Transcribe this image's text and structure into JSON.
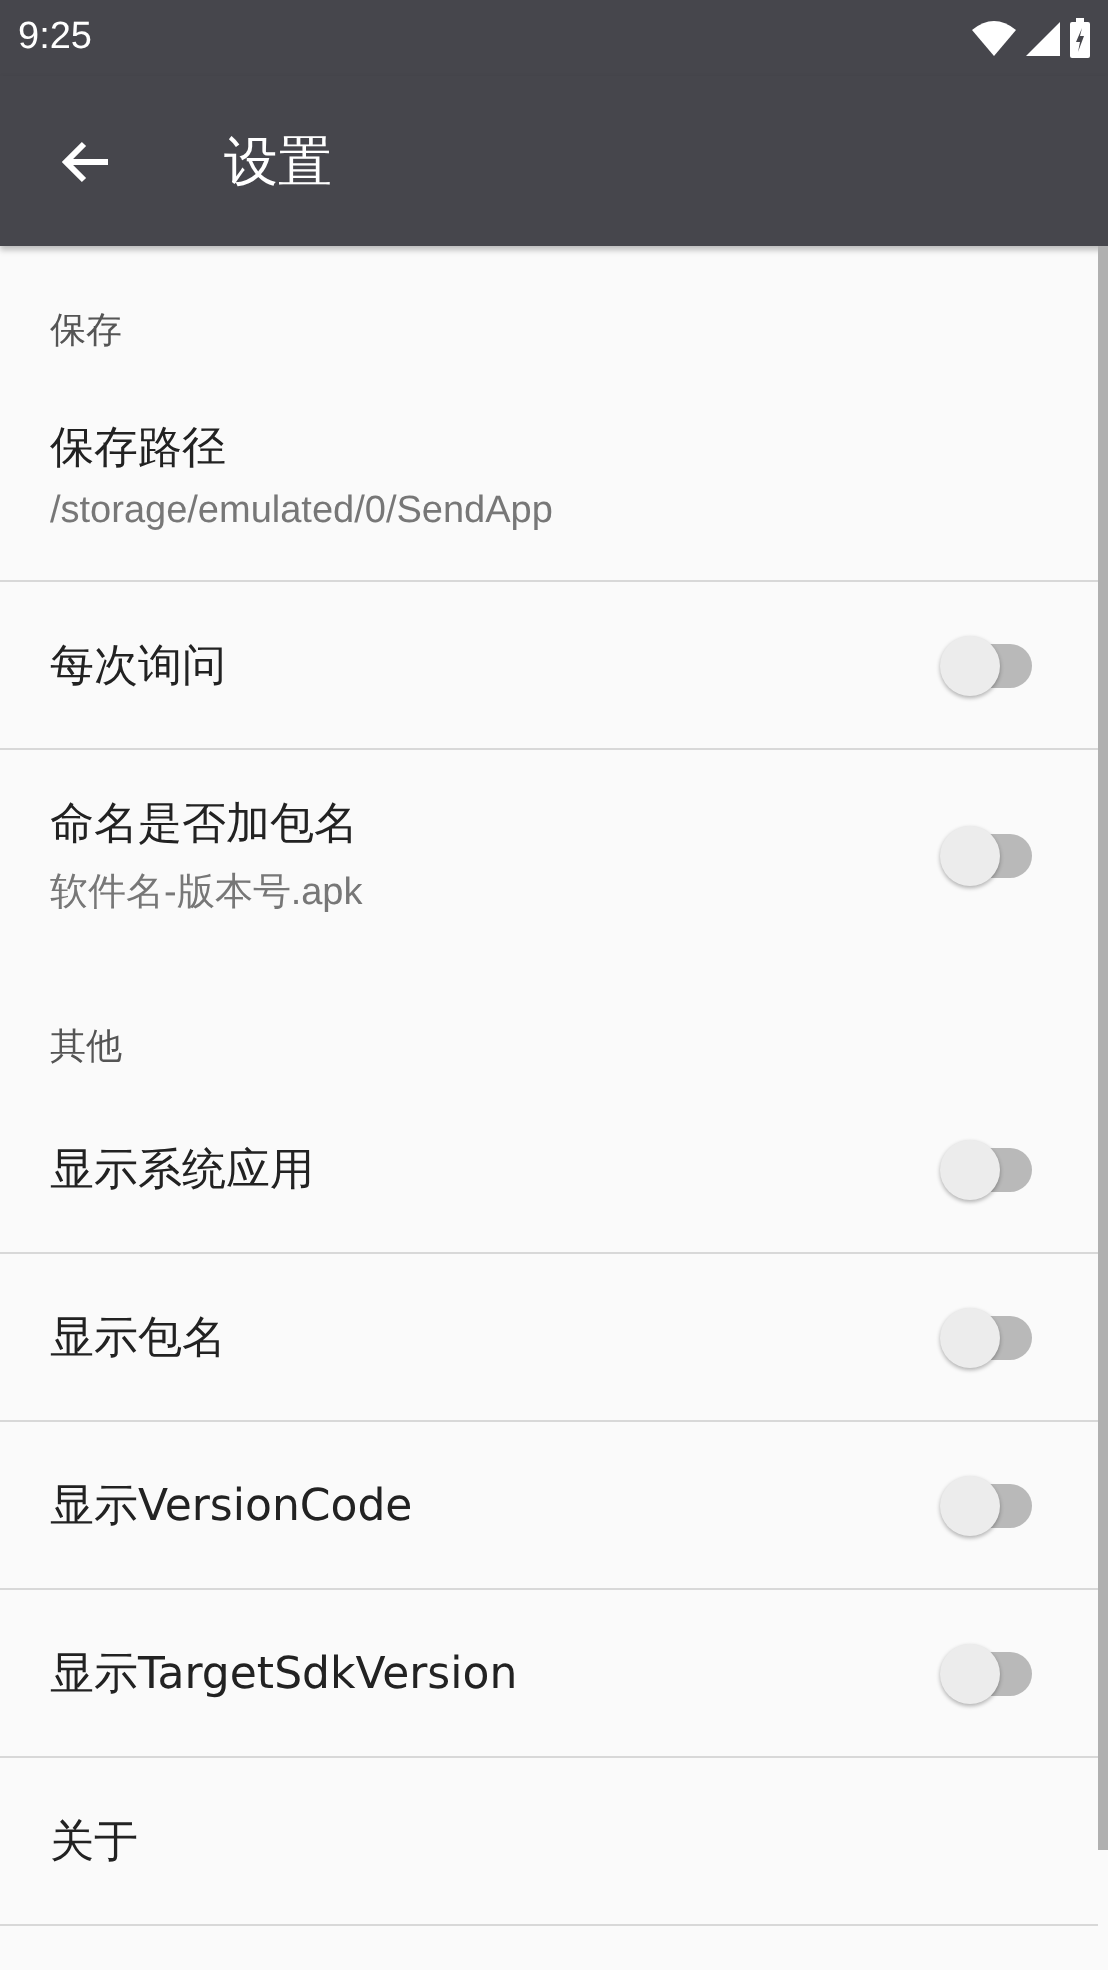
{
  "status_bar": {
    "time": "9:25"
  },
  "toolbar": {
    "title": "设置"
  },
  "sections": [
    {
      "header": "保存",
      "items": [
        {
          "kind": "text",
          "title": "保存路径",
          "summary": "/storage/emulated/0/SendApp"
        },
        {
          "kind": "switch",
          "title": "每次询问",
          "on": false
        },
        {
          "kind": "switch",
          "title": "命名是否加包名",
          "summary": "软件名-版本号.apk",
          "on": false
        }
      ]
    },
    {
      "header": "其他",
      "items": [
        {
          "kind": "switch",
          "title": "显示系统应用",
          "on": false
        },
        {
          "kind": "switch",
          "title": "显示包名",
          "on": false
        },
        {
          "kind": "switch",
          "title": "显示VersionCode",
          "on": false
        },
        {
          "kind": "switch",
          "title": "显示TargetSdkVersion",
          "on": false
        },
        {
          "kind": "text",
          "title": "关于"
        }
      ]
    }
  ]
}
